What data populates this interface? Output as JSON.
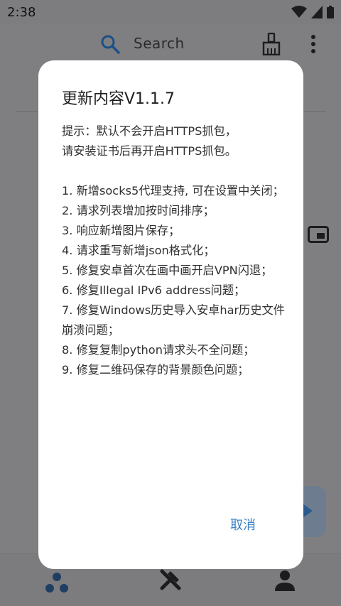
{
  "status_bar": {
    "time": "2:38",
    "icons": [
      "wifi-icon",
      "signal-icon",
      "battery-icon"
    ]
  },
  "app_bar": {
    "search_placeholder": "Search",
    "icons": [
      "search-icon",
      "broom-icon",
      "more-vert-icon"
    ]
  },
  "dialog": {
    "title": "更新内容V1.1.7",
    "tip_lines": [
      "提示：默认不会开启HTTPS抓包，",
      "请安装证书后再开启HTTPS抓包。"
    ],
    "items": [
      "1. 新增socks5代理支持, 可在设置中关闭；",
      "2. 请求列表增加按时间排序；",
      "3. 响应新增图片保存；",
      "4. 请求重写新增json格式化；",
      "5. 修复安卓首次在画中画开启VPN闪退；",
      "6. 修复Illegal IPv6 address问题；",
      "7. 修复Windows历史导入安卓har历史文件崩溃问题；",
      "8. 修复复制python请求头不全问题；",
      "9. 修复二维码保存的背景颜色问题；"
    ],
    "cancel_label": "取消"
  },
  "bottom_nav": {
    "items": [
      "home-icon",
      "tools-icon",
      "profile-icon"
    ]
  },
  "colors": {
    "accent": "#3b82c4",
    "scrim": "#7f7f81",
    "dialog_bg": "#ffffff"
  }
}
